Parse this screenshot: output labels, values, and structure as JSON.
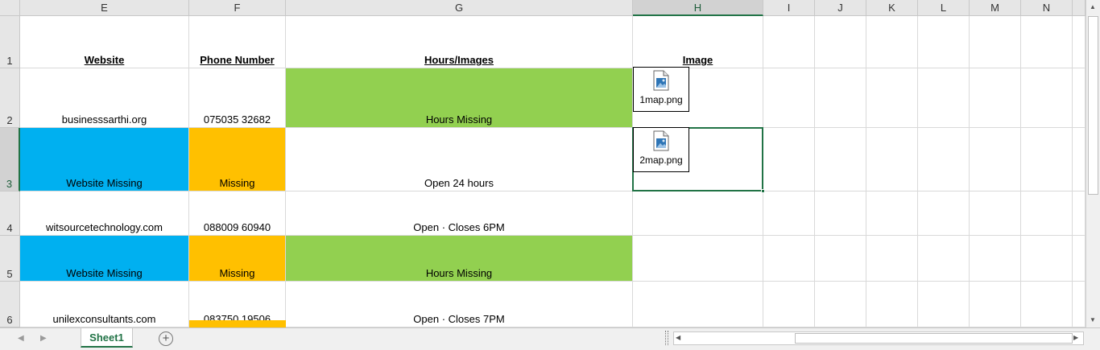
{
  "columns": [
    {
      "id": "E",
      "label": "E"
    },
    {
      "id": "F",
      "label": "F"
    },
    {
      "id": "G",
      "label": "G"
    },
    {
      "id": "H",
      "label": "H"
    },
    {
      "id": "I",
      "label": "I"
    },
    {
      "id": "J",
      "label": "J"
    },
    {
      "id": "K",
      "label": "K"
    },
    {
      "id": "L",
      "label": "L"
    },
    {
      "id": "M",
      "label": "M"
    },
    {
      "id": "N",
      "label": "N"
    }
  ],
  "selected_column": "H",
  "selected_row": "3",
  "rows": [
    {
      "label": "1",
      "cells": {
        "E": {
          "text": "Website",
          "fill": "",
          "header": true
        },
        "F": {
          "text": "Phone Number",
          "fill": "",
          "header": true
        },
        "G": {
          "text": "Hours/Images",
          "fill": "",
          "header": true
        },
        "H": {
          "text": "Image",
          "fill": "",
          "header": true
        }
      }
    },
    {
      "label": "2",
      "cells": {
        "E": {
          "text": "businesssarthi.org",
          "fill": ""
        },
        "F": {
          "text": "075035 32682",
          "fill": ""
        },
        "G": {
          "text": "Hours Missing",
          "fill": "#92d050"
        },
        "H": {
          "text": "",
          "fill": ""
        }
      }
    },
    {
      "label": "3",
      "cells": {
        "E": {
          "text": "Website Missing",
          "fill": "#00b0f0"
        },
        "F": {
          "text": "Missing",
          "fill": "#ffc000"
        },
        "G": {
          "text": "Open 24 hours",
          "fill": ""
        },
        "H": {
          "text": "",
          "fill": ""
        }
      }
    },
    {
      "label": "4",
      "cells": {
        "E": {
          "text": "witsourcetechnology.com",
          "fill": ""
        },
        "F": {
          "text": "088009 60940",
          "fill": ""
        },
        "G": {
          "text": "Open · Closes 6PM",
          "fill": ""
        },
        "H": {
          "text": "",
          "fill": ""
        }
      }
    },
    {
      "label": "5",
      "cells": {
        "E": {
          "text": "Website Missing",
          "fill": "#00b0f0"
        },
        "F": {
          "text": "Missing",
          "fill": "#ffc000"
        },
        "G": {
          "text": "Hours Missing",
          "fill": "#92d050"
        },
        "H": {
          "text": "",
          "fill": ""
        }
      }
    },
    {
      "label": "6",
      "cells": {
        "E": {
          "text": "unilexconsultants.com",
          "fill": ""
        },
        "F": {
          "text": "083750 19506",
          "fill": ""
        },
        "G": {
          "text": "Open · Closes 7PM",
          "fill": ""
        },
        "H": {
          "text": "",
          "fill": ""
        }
      }
    }
  ],
  "embedded_files": [
    {
      "name": "1map.png",
      "icon": "image-file-icon"
    },
    {
      "name": "2map.png",
      "icon": "image-file-icon"
    }
  ],
  "sheet_tabs": [
    {
      "label": "Sheet1",
      "active": true
    }
  ],
  "icons": {
    "add_sheet": "plus-circle-icon",
    "nav_prev": "left-arrow-icon",
    "nav_next": "right-arrow-icon"
  },
  "colors": {
    "excel_green": "#217346",
    "blue_fill": "#00b0f0",
    "orange_fill": "#ffc000",
    "green_fill": "#92d050"
  }
}
